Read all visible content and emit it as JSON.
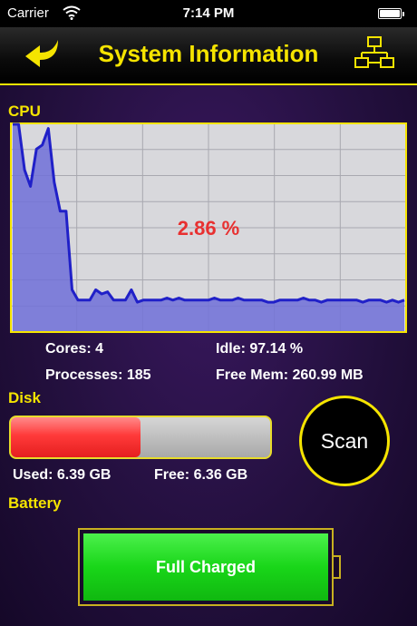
{
  "status_bar": {
    "carrier": "Carrier",
    "wifi_icon": "wifi-icon",
    "time": "7:14 PM",
    "battery_icon": "battery-full-icon"
  },
  "nav": {
    "title": "System Information",
    "back_icon": "curved-arrow-left-icon",
    "right_icon": "network-tree-icon"
  },
  "cpu": {
    "label": "CPU",
    "usage_text": "2.86 %",
    "stats": {
      "cores": "Cores: 4",
      "idle": "Idle: 97.14 %",
      "processes": "Processes: 185",
      "free_mem": "Free Mem: 260.99 MB"
    }
  },
  "disk": {
    "label": "Disk",
    "used_fraction": 0.5,
    "used": "Used: 6.39 GB",
    "free": "Free: 6.36 GB",
    "scan_label": "Scan"
  },
  "battery": {
    "label": "Battery",
    "status": "Full Charged",
    "level_fraction": 1.0
  },
  "colors": {
    "accent": "#f5e400",
    "cpu_line": "#2020c8",
    "cpu_fill": "#7070d8",
    "cpu_text": "#e83030",
    "disk_used": "#ff3a3a",
    "battery_fill": "#19d619"
  },
  "chart_data": {
    "type": "area",
    "title": "",
    "xlabel": "",
    "ylabel": "",
    "ylim": [
      0,
      100
    ],
    "grid": true,
    "values": [
      100,
      100,
      78,
      70,
      88,
      90,
      98,
      72,
      58,
      58,
      20,
      15,
      15,
      15,
      20,
      18,
      19,
      15,
      15,
      15,
      20,
      14,
      15,
      15,
      15,
      15,
      16,
      15,
      16,
      15,
      15,
      15,
      15,
      15,
      16,
      15,
      15,
      15,
      16,
      15,
      15,
      15,
      15,
      14,
      14,
      15,
      15,
      15,
      15,
      16,
      15,
      15,
      14,
      15,
      15,
      15,
      15,
      15,
      15,
      14,
      15,
      15,
      15,
      14,
      15,
      14,
      15
    ]
  }
}
